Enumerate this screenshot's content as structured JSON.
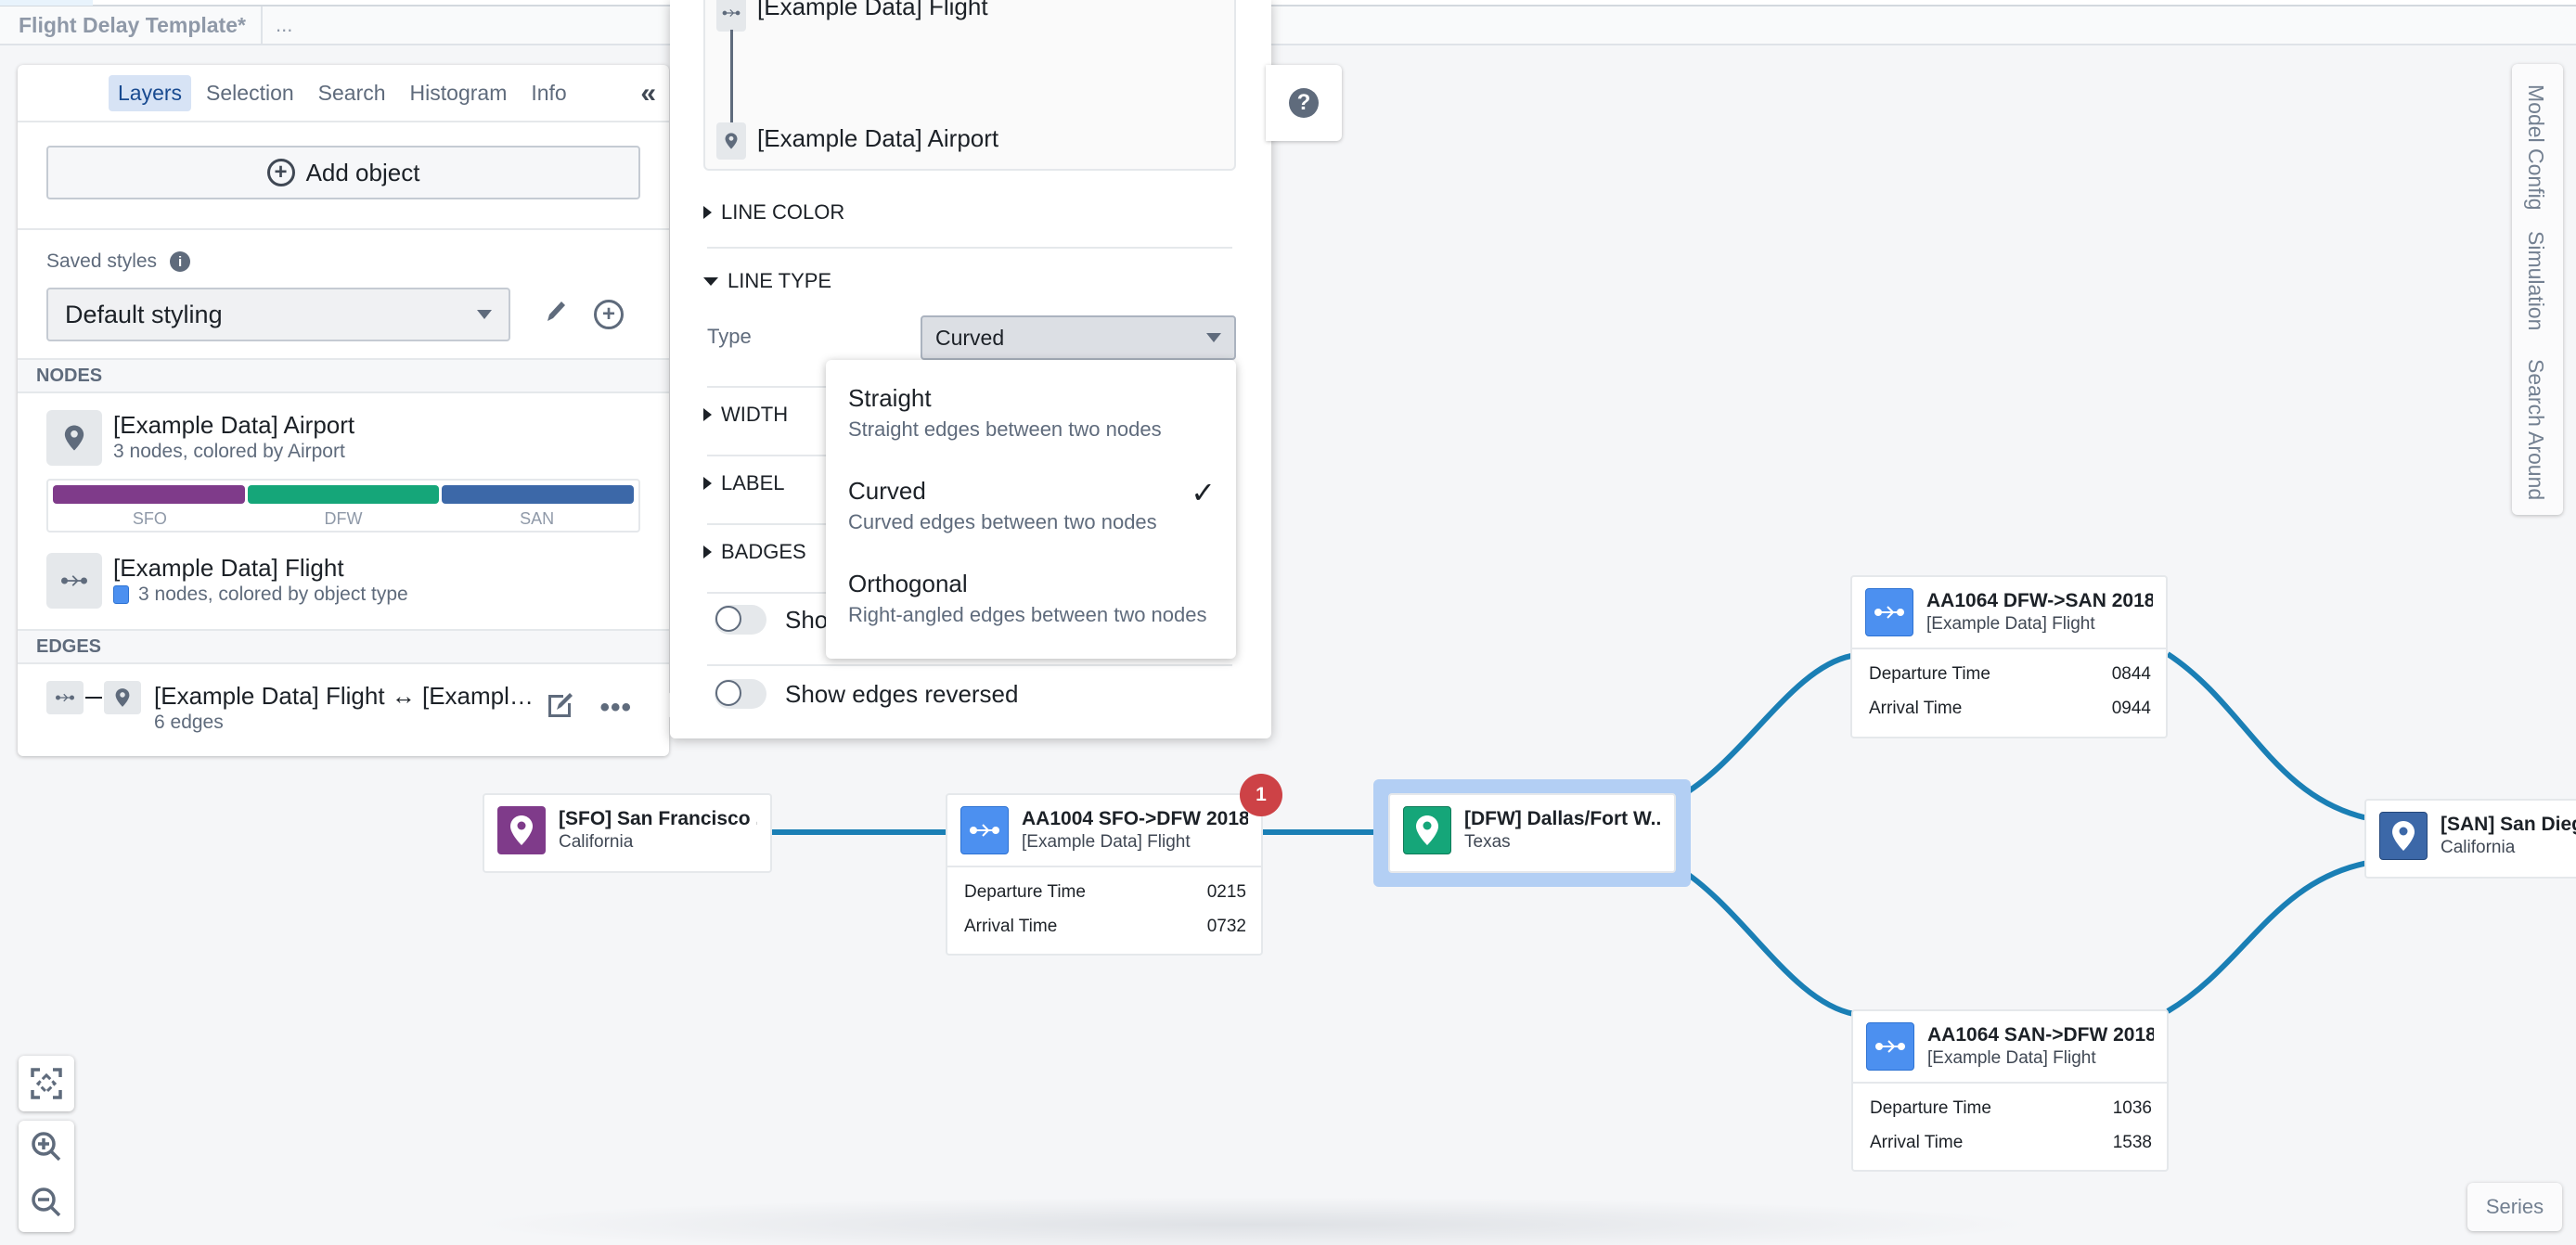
{
  "app": {
    "document_title": "Flight Delay Template*",
    "title_more": "..."
  },
  "left_panel": {
    "tabs": [
      {
        "label": "Layers",
        "active": true
      },
      {
        "label": "Selection",
        "active": false
      },
      {
        "label": "Search",
        "active": false
      },
      {
        "label": "Histogram",
        "active": false
      },
      {
        "label": "Info",
        "active": false
      }
    ],
    "collapse_icon": "double-chevron-left-icon",
    "add_object_label": "Add object",
    "saved_styles_label": "Saved styles",
    "saved_styles_value": "Default styling",
    "nodes_header": "NODES",
    "node_layers": [
      {
        "title": "[Example Data] Airport",
        "subtitle": "3 nodes, colored by Airport",
        "icon": "map-marker-icon",
        "legend": [
          {
            "label": "SFO",
            "color": "#7f3b8a"
          },
          {
            "label": "DFW",
            "color": "#15a679"
          },
          {
            "label": "SAN",
            "color": "#3c68a8"
          }
        ]
      },
      {
        "title": "[Example Data] Flight",
        "subtitle": "3 nodes, colored by object type",
        "icon": "flight-route-icon",
        "swatch_color": "#4c90f0"
      }
    ],
    "edges_header": "EDGES",
    "edge_layer": {
      "title": "[Example Data] Flight ↔ [Exampl…",
      "subtitle": "6 edges"
    }
  },
  "edge_style_popover": {
    "path_from": "[Example Data] Flight",
    "path_to": "[Example Data] Airport",
    "sections": {
      "line_color": "LINE COLOR",
      "line_type": "LINE TYPE",
      "width": "WIDTH",
      "label": "LABEL",
      "badges": "BADGES"
    },
    "type_label": "Type",
    "type_value": "Curved",
    "toggle_partial_label": "Sho",
    "toggle_show_reversed": "Show edges reversed",
    "type_options": [
      {
        "title": "Straight",
        "description": "Straight edges between two nodes",
        "selected": false
      },
      {
        "title": "Curved",
        "description": "Curved edges between two nodes",
        "selected": true
      },
      {
        "title": "Orthogonal",
        "description": "Right-angled edges between two nodes",
        "selected": false
      }
    ]
  },
  "right_tabs": [
    "Model Config",
    "Simulation",
    "Search Around"
  ],
  "series_label": "Series",
  "graph": {
    "edge_color": "#1a7fb5",
    "nodes": [
      {
        "id": "sfo",
        "title": "[SFO] San Francisco ...",
        "subtitle": "California",
        "type": "airport",
        "color": "#7f3b8a"
      },
      {
        "id": "aa1004",
        "title": "AA1004 SFO->DFW 2018...",
        "subtitle": "[Example Data] Flight",
        "type": "flight",
        "color": "#4c90f0",
        "badge": "1",
        "props": [
          {
            "label": "Departure Time",
            "value": "0215"
          },
          {
            "label": "Arrival Time",
            "value": "0732"
          }
        ]
      },
      {
        "id": "dfw",
        "title": "[DFW] Dallas/Fort W...",
        "subtitle": "Texas",
        "type": "airport",
        "color": "#15a679",
        "selected": true
      },
      {
        "id": "aa1064a",
        "title": "AA1064 DFW->SAN 2018...",
        "subtitle": "[Example Data] Flight",
        "type": "flight",
        "color": "#4c90f0",
        "props": [
          {
            "label": "Departure Time",
            "value": "0844"
          },
          {
            "label": "Arrival Time",
            "value": "0944"
          }
        ]
      },
      {
        "id": "aa1064b",
        "title": "AA1064 SAN->DFW 2018...",
        "subtitle": "[Example Data] Flight",
        "type": "flight",
        "color": "#4c90f0",
        "props": [
          {
            "label": "Departure Time",
            "value": "1036"
          },
          {
            "label": "Arrival Time",
            "value": "1538"
          }
        ]
      },
      {
        "id": "san",
        "title": "[SAN] San Diego",
        "subtitle": "California",
        "type": "airport",
        "color": "#3c68a8"
      }
    ]
  }
}
